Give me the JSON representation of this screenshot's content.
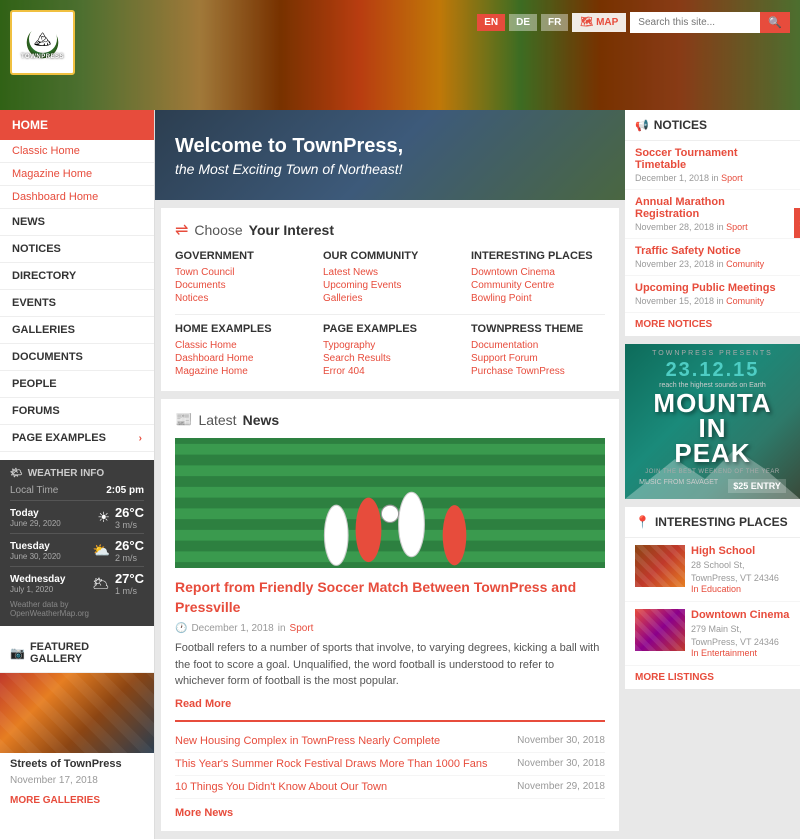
{
  "header": {
    "logo_text": "TOWNPRESS",
    "logo_subtitle": "🏔",
    "lang_en": "EN",
    "lang_de": "DE",
    "lang_fr": "FR",
    "map_label": "MAP",
    "search_placeholder": "Search this site...",
    "search_btn": "🔍"
  },
  "nav": {
    "home": "HOME",
    "classic_home": "Classic Home",
    "magazine_home": "Magazine Home",
    "dashboard_home": "Dashboard Home",
    "news": "NEWS",
    "notices": "NOTICES",
    "directory": "DIRECTORY",
    "events": "EVENTS",
    "galleries": "GALLERIES",
    "documents": "DOCUMENTS",
    "people": "PEOPLE",
    "forums": "FORUMS",
    "page_examples": "PAGE EXAMPLES"
  },
  "weather": {
    "title": "WEATHER INFO",
    "local_time_label": "Local Time",
    "local_time": "2:05 pm",
    "days": [
      {
        "day": "Today",
        "date": "June 29, 2020",
        "icon": "☀",
        "temp": "26°C",
        "wind": "3 m/s"
      },
      {
        "day": "Tuesday",
        "date": "June 30, 2020",
        "icon": "⛅",
        "temp": "26°C",
        "wind": "2 m/s"
      },
      {
        "day": "Wednesday",
        "date": "July 1, 2020",
        "icon": "🌥",
        "temp": "27°C",
        "wind": "1 m/s"
      }
    ],
    "credit": "Weather data by OpenWeatherMap.org"
  },
  "gallery": {
    "title": "FEATURED GALLERY",
    "caption": "Streets of TownPress",
    "date": "November 17, 2018",
    "more": "MORE GALLERIES"
  },
  "welcome": {
    "title": "Welcome to TownPress,",
    "subtitle": "the Most Exciting Town of Northeast!"
  },
  "interest": {
    "section_title_plain": "Choose ",
    "section_title_bold": "Your Interest",
    "col1_header": "GOVERNMENT",
    "col1_links": [
      "Town Council",
      "Documents",
      "Notices"
    ],
    "col2_header": "OUR COMMUNITY",
    "col2_links": [
      "Latest News",
      "Upcoming Events",
      "Galleries"
    ],
    "col3_header": "INTERESTING PLACES",
    "col3_links": [
      "Downtown Cinema",
      "Community Centre",
      "Bowling Point"
    ],
    "col4_header": "HOME EXAMPLES",
    "col4_links": [
      "Classic Home",
      "Dashboard Home",
      "Magazine Home"
    ],
    "col5_header": "PAGE EXAMPLES",
    "col5_links": [
      "Typography",
      "Search Results",
      "Error 404"
    ],
    "col6_header": "TOWNPRESS THEME",
    "col6_links": [
      "Documentation",
      "Support Forum",
      "Purchase TownPress"
    ]
  },
  "news": {
    "section_title_plain": "Latest ",
    "section_title_bold": "News",
    "main_headline": "Report from Friendly Soccer Match Between TownPress and Pressville",
    "main_date": "December 1, 2018",
    "main_category": "Sport",
    "main_excerpt": "Football refers to a number of sports that involve, to varying degrees, kicking a ball with the foot to score a goal. Unqualified, the word football is understood to refer to whichever form of football is the most popular.",
    "read_more": "Read More",
    "news_list": [
      {
        "title": "New Housing Complex in TownPress Nearly Complete",
        "date": "November 30, 2018"
      },
      {
        "title": "This Year's Summer Rock Festival Draws More Than 1000 Fans",
        "date": "November 30, 2018"
      },
      {
        "title": "10 Things You Didn't Know About Our Town",
        "date": "November 29, 2018"
      }
    ],
    "more_news": "More News"
  },
  "notices": {
    "title": "NOTICES",
    "items": [
      {
        "title": "Soccer Tournament Timetable",
        "date": "December 1, 2018",
        "category": "Sport"
      },
      {
        "title": "Annual Marathon Registration",
        "date": "November 28, 2018",
        "category": "Sport"
      },
      {
        "title": "Traffic Safety Notice",
        "date": "November 23, 2018",
        "category": "Comunity"
      },
      {
        "title": "Upcoming Public Meetings",
        "date": "November 15, 2018",
        "category": "Comunity"
      }
    ],
    "more": "MORE NOTICES"
  },
  "ad": {
    "date": "23.12.15",
    "tagline": "reach the highest sounds on Earth",
    "title1": "MOUNTA",
    "title2": "IN",
    "title3": "PEAK",
    "subtitle": "JOIN THE BEST WEEKEND OF THE YEAR",
    "music": "MUSIC FROM SAVAGET",
    "price": "$25 ENTRY"
  },
  "places": {
    "title": "INTERESTING PLACES",
    "items": [
      {
        "name": "High School",
        "address": "28 School St,\nTownPress, VT 24346",
        "category": "In Education"
      },
      {
        "name": "Downtown Cinema",
        "address": "279 Main St,\nTownPress, VT 24346",
        "category": "In Entertainment"
      }
    ],
    "more": "MORE LISTINGS"
  }
}
